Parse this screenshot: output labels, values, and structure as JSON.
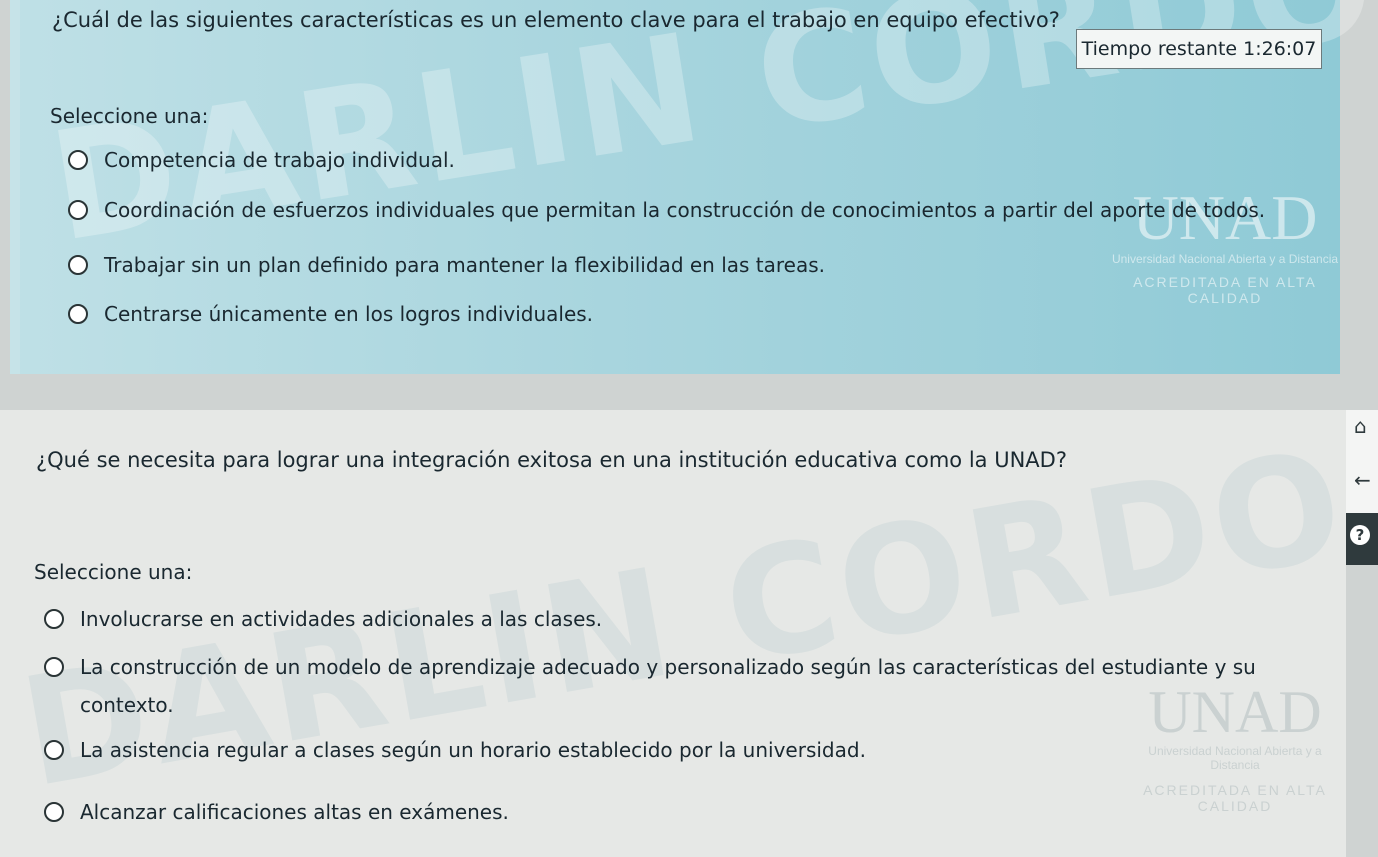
{
  "question1": {
    "text": "¿Cuál de las siguientes características es un elemento clave para el trabajo en equipo efectivo?",
    "select_label": "Seleccione una:",
    "options": [
      "Competencia de trabajo individual.",
      "Coordinación de esfuerzos individuales que permitan la construcción de conocimientos a partir del aporte de todos.",
      "Trabajar sin un plan definido para mantener la flexibilidad en las tareas.",
      "Centrarse únicamente en los logros individuales."
    ]
  },
  "timer": {
    "label": "Tiempo restante",
    "value": "1:26:07"
  },
  "question2": {
    "text": "¿Qué se necesita para lograr una integración exitosa en una institución educativa como la UNAD?",
    "select_label": "Seleccione una:",
    "options": [
      "Involucrarse en actividades adicionales a las clases.",
      "La construcción de un modelo de aprendizaje adecuado y personalizado según las características del estudiante y su contexto.",
      "La asistencia regular a clases según un horario establecido por la universidad.",
      "Alcanzar calificaciones altas en exámenes."
    ]
  },
  "watermark": {
    "name_line": "DARLIN CORDOBA MARTINEZ",
    "logo_text": "UNAD",
    "institution": "Universidad Nacional Abierta y a Distancia",
    "accreditation": "ACREDITADA EN ALTA CALIDAD"
  },
  "nav": {
    "icons": [
      "home-icon",
      "back-arrow-icon",
      "help-icon"
    ]
  }
}
